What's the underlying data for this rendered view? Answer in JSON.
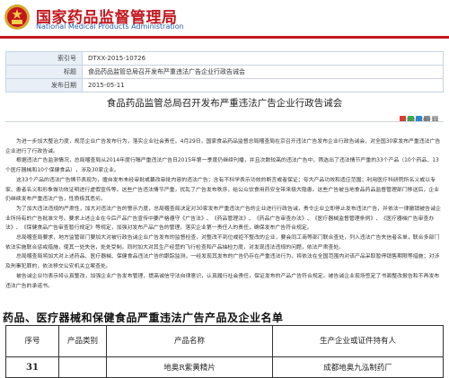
{
  "header": {
    "site_name": "国家药品监督管理局",
    "site_name_en": "National Medical Products Administration"
  },
  "meta": {
    "rows": [
      {
        "label": "索引号",
        "value": "DTXX-2015-10726"
      },
      {
        "label": "标题",
        "value": "食品药品监管总局召开发布严重违法广告企业行政告诫会"
      },
      {
        "label": "发布日期",
        "value": "2015-05-11"
      }
    ]
  },
  "article": {
    "date": "2015－05－11",
    "title": "食品药品监管总局召开发布严重违法广告企业行政告诫会",
    "paragraphs": [
      "为进一步加大整治力度，规范企业广告发布行为，落实企业社会责任。4月29日，国家食品药品监督总局稽查局在京召开违法广告发布企业行政告诫会，对全国30家发布严重违法广告企业进行了行政告诫。",
      "根据违法广告监测情况，总局稽查局从2014年度行隔严重违法广告日2015年第一季度仍继续刊播，并且次数较高的违法广告中，筛选出了违法情节严重的33个产品（10个药品、13个医疗器械和10个保健食品），涉及30家企业。",
      "这33个产品的违法广告情节表现为，擅自发布未经审批或篡改审批内容的违法广告；含有不科学表示功效的断言或者保证；夸大产品功效和适应范围；利用医疗科研院所名义或以专家、患者名义和形象做功效证明进行虚假宣传等。这些广告违法情节严重，扰乱了广告发布秩序，给公众饮食用药安全带来极大隐患。这些广告被当地食品药品监督管理部门移送后，企业仍继续发布严重违法广告，性质极其恶劣。",
      "为了加大违法违规的严肃性，加大对违法广告的警示力度，总局稽查局决定对30家发布严重违法广告的企业进行行政告诫，责令企业立即停止发布违法广告，并依法一律撤销被告诫企业所持有的广告批准文号。要求上述企业在今后产品广告宣传中要严格遵守《广告法》、《药品管理法》、《药品广告审查办法》、《医疗器械监督管理条例》、《医疗器械广告审查办法》、《保健食品广告审查暂行规定》等规定，加强对发布产品广告的管理，落实企业第一责任人的责任，确保发布广告符合规定。",
      "总局稽查局要求，地方监管部门要加大对被行政告诫企业广告发布的监督检查，对整改不到位或拒不整改的企业，要会同工商等部门联合查处，列入违法广告失信者名单，联合多部门依法实施联合惩戒措施，使其一处失信，处处受制。同时加大对其生产经营的飞行检查和产品抽检力度，对发现违法违规的问题，依法严肃查处。",
      "总局稽查局将加大对上述药品、医疗器械、保健食品违法广告的跟踪监测，一经发现其发布的广告仍存在严重违法行为，将依法在全国范围内对该产品采取暂停销售期限等措施；对涉及刑事犯罪的，依法移交公安机关立案查处。",
      "被告诫企业均表示将认真整改，加强企业广告发布管理，提高诚信守法自律意识，认真履行社会责任，保证发布的产品广告符合规定。被告诫企业现场签定了书面整改报告和不再发布违法广告的承诺书。"
    ]
  },
  "products": {
    "section_title": "药品、医疗器械和保健食品严重违法广告产品及企业名单",
    "columns": [
      "序号",
      "产品类别",
      "产品名称",
      "生产企业或证件持有人"
    ],
    "rows": [
      {
        "no": "31",
        "category": "",
        "name": "地奥R紫黄精片",
        "company": "成都地奥九泓制药厂"
      }
    ]
  },
  "colors": {
    "brand_red": "#c4161c",
    "link_blue": "#2a5fa8",
    "meta_bg": "#e9eff7"
  },
  "toolbar_icons": [
    "share-weibo-icon",
    "share-wechat-icon",
    "share-qq-icon",
    "print-icon",
    "close-icon"
  ]
}
